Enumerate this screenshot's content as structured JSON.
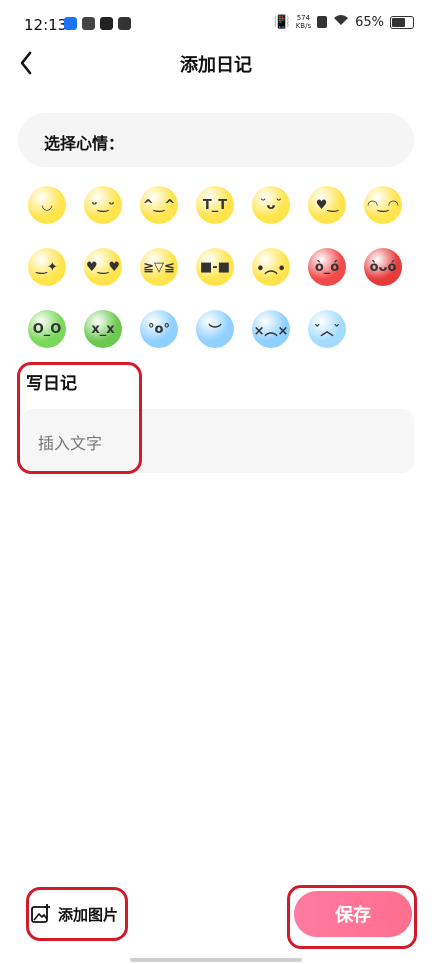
{
  "status_bar": {
    "time": "12:13",
    "net_speed_value": "574",
    "net_speed_unit": "KB/s",
    "battery": "65%"
  },
  "header": {
    "title": "添加日记"
  },
  "mood": {
    "label": "选择心情：",
    "emojis": [
      {
        "name": "smile-emoji",
        "color": "#ffe44d",
        "face": "◡"
      },
      {
        "name": "grin-emoji",
        "color": "#ffe44d",
        "face": "ᵕ‿ᵕ"
      },
      {
        "name": "blush-emoji",
        "color": "#ffe44d",
        "face": "^‿^"
      },
      {
        "name": "crying-emoji",
        "color": "#ffe44d",
        "face": "T_T"
      },
      {
        "name": "tongue-emoji",
        "color": "#ffe44d",
        "face": "˘ᴗ˘"
      },
      {
        "name": "heart-wink-emoji",
        "color": "#ffe44d",
        "face": "♥‿"
      },
      {
        "name": "halo-emoji",
        "color": "#ffe44d",
        "face": "◠‿◠"
      },
      {
        "name": "sparkle-emoji",
        "color": "#ffe44d",
        "face": "‿✦"
      },
      {
        "name": "heart-eyes-emoji",
        "color": "#ffe44d",
        "face": "♥‿♥"
      },
      {
        "name": "laugh-tears-emoji",
        "color": "#ffe44d",
        "face": "≧▽≦"
      },
      {
        "name": "sunglasses-emoji",
        "color": "#ffe44d",
        "face": "■-■"
      },
      {
        "name": "worried-emoji",
        "color": "#ffe44d",
        "face": "•︵•"
      },
      {
        "name": "angry-red-emoji",
        "color": "#f24949",
        "face": "ò_ó"
      },
      {
        "name": "devil-emoji",
        "color": "#e63b3b",
        "face": "òᴗó"
      },
      {
        "name": "shocked-green-emoji",
        "color": "#7ad85a",
        "face": "O_O"
      },
      {
        "name": "sick-green-emoji",
        "color": "#6cc94f",
        "face": "x_x"
      },
      {
        "name": "scared-blue-emoji",
        "color": "#8fd0ff",
        "face": "°o°"
      },
      {
        "name": "sad-blue-emoji",
        "color": "#8fd0ff",
        "face": "︶"
      },
      {
        "name": "upset-blue-emoji",
        "color": "#8fd0ff",
        "face": "×︵×"
      },
      {
        "name": "cold-blue-emoji",
        "color": "#a4dcff",
        "face": "ˇ︿ˇ"
      }
    ]
  },
  "diary": {
    "section_title": "写日记",
    "placeholder": "插入文字"
  },
  "footer": {
    "add_image_label": "添加图片",
    "save_label": "保存"
  },
  "colors": {
    "save_gradient_start": "#ff7aa0",
    "save_gradient_end": "#ff6f8e",
    "annotation": "#d31a2b"
  }
}
